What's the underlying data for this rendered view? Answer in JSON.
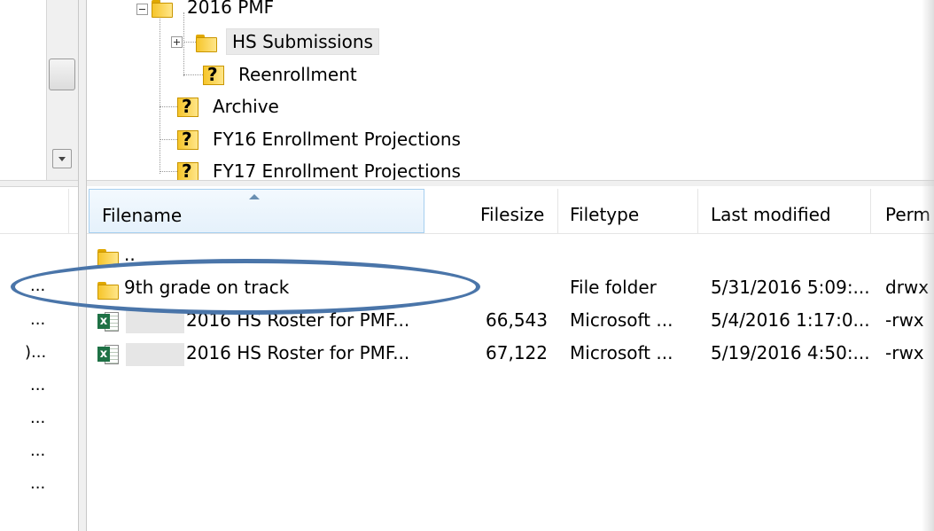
{
  "tree": {
    "items": [
      {
        "label": "2016 PMF",
        "icon": "folder-icon"
      },
      {
        "label": "HS Submissions",
        "icon": "folder-icon"
      },
      {
        "label": "Reenrollment",
        "icon": "unknown-folder-icon"
      },
      {
        "label": "Archive",
        "icon": "unknown-folder-icon"
      },
      {
        "label": "FY16 Enrollment Projections",
        "icon": "unknown-folder-icon"
      },
      {
        "label": "FY17 Enrollment Projections",
        "icon": "unknown-folder-icon"
      }
    ]
  },
  "file_list": {
    "columns": {
      "filename": "Filename",
      "filesize": "Filesize",
      "filetype": "Filetype",
      "modified": "Last modified",
      "perms": "Perm"
    },
    "rows": [
      {
        "name": "..",
        "size": "",
        "type": "",
        "modified": "",
        "perms": "",
        "icon": "folder-icon"
      },
      {
        "name": "9th grade on track",
        "size": "",
        "type": "File folder",
        "modified": "5/31/2016 5:09:...",
        "perms": "drwx",
        "icon": "folder-icon"
      },
      {
        "name": "2016 HS Roster for PMF...",
        "size": "66,543",
        "type": "Microsoft ...",
        "modified": "5/4/2016 1:17:0...",
        "perms": "-rwx",
        "icon": "excel-file-icon"
      },
      {
        "name": "2016 HS Roster for PMF...",
        "size": "67,122",
        "type": "Microsoft ...",
        "modified": "5/19/2016 4:50:...",
        "perms": "-rwx",
        "icon": "excel-file-icon"
      }
    ]
  },
  "left_list": {
    "rows": [
      "...",
      "...",
      ")...",
      "...",
      "...",
      "...",
      "..."
    ]
  },
  "colors": {
    "highlight_ellipse": "#4a75a9",
    "sorted_header": "#e5f1fb"
  }
}
